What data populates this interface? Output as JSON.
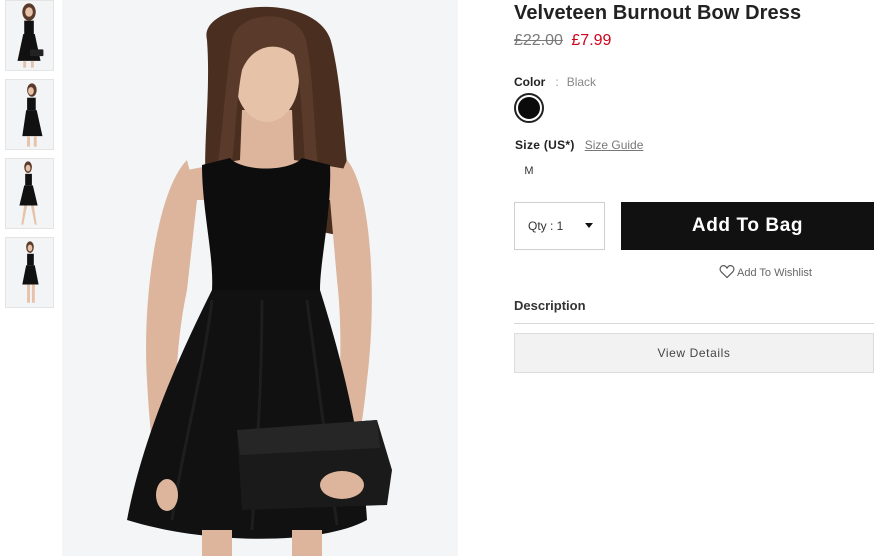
{
  "product": {
    "title": "Velveteen Burnout Bow Dress",
    "price_original": "£22.00",
    "price_sale": "£7.99"
  },
  "color": {
    "label": "Color",
    "separator": ":",
    "value": "Black",
    "swatch_hex": "#0b0b0b"
  },
  "size": {
    "label": "Size (US*)",
    "guide_label": "Size Guide",
    "options": [
      "M"
    ]
  },
  "quantity": {
    "label": "Qty : 1"
  },
  "actions": {
    "add_to_bag": "Add To Bag",
    "wishlist": "Add To Wishlist"
  },
  "description": {
    "heading": "Description",
    "view_details": "View Details"
  },
  "colors": {
    "sale_price": "#d0021b",
    "button_bg": "#111111",
    "image_bg": "#f4f5f7"
  }
}
